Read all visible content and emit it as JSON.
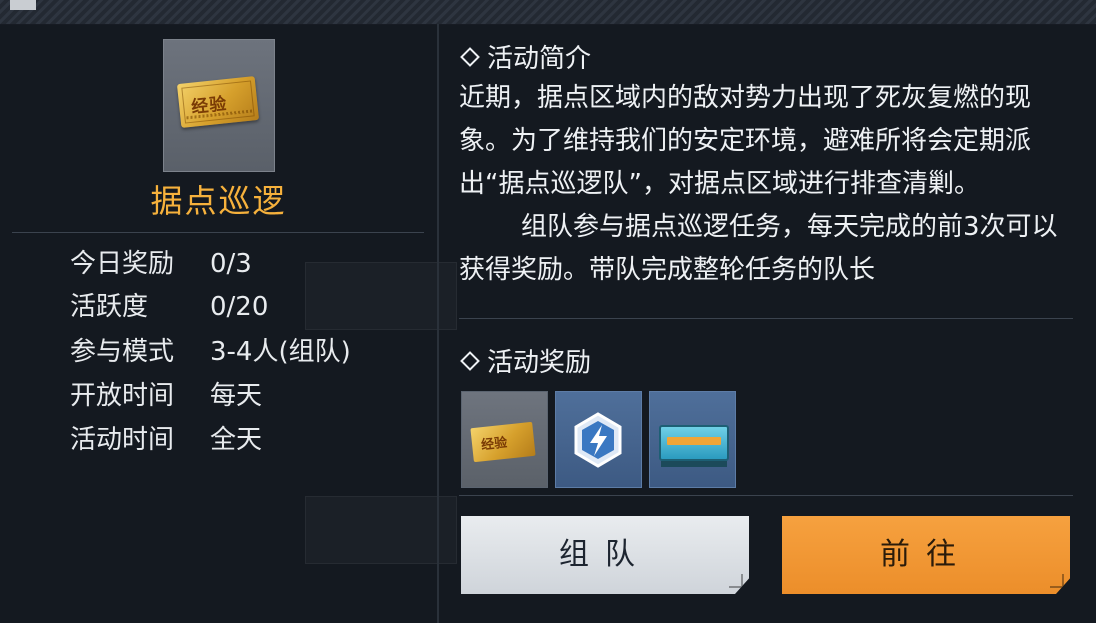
{
  "activity": {
    "name": "据点巡逻",
    "item_icon": "exp-ticket-icon",
    "item_text": "经验"
  },
  "info_rows": [
    {
      "label": "今日奖励",
      "value": "0/3"
    },
    {
      "label": "活跃度",
      "value": "0/20"
    },
    {
      "label": "参与模式",
      "value": "3-4人(组队)"
    },
    {
      "label": "开放时间",
      "value": "每天"
    },
    {
      "label": "活动时间",
      "value": "全天"
    }
  ],
  "intro": {
    "title": "活动简介",
    "paragraph1": "近期，据点区域内的敌对势力出现了死灰复燃的现象。为了维持我们的安定环境，避难所将会定期派出“据点巡逻队”，对据点区域进行排查清剿。",
    "paragraph2": "组队参与据点巡逻任务，每天完成的前3次可以获得奖励。带队完成整轮任务的队长"
  },
  "rewards": {
    "title": "活动奖励",
    "items": [
      {
        "icon": "exp-ticket-icon",
        "text": "经验"
      },
      {
        "icon": "energy-hexagon-icon"
      },
      {
        "icon": "supply-crate-icon"
      }
    ]
  },
  "buttons": {
    "team": "组队",
    "go": "前往"
  },
  "colors": {
    "accent_orange": "#f6b13c",
    "go_button": "#f39a36",
    "team_button": "#dfe3e7",
    "panel_bg": "#151a21"
  }
}
